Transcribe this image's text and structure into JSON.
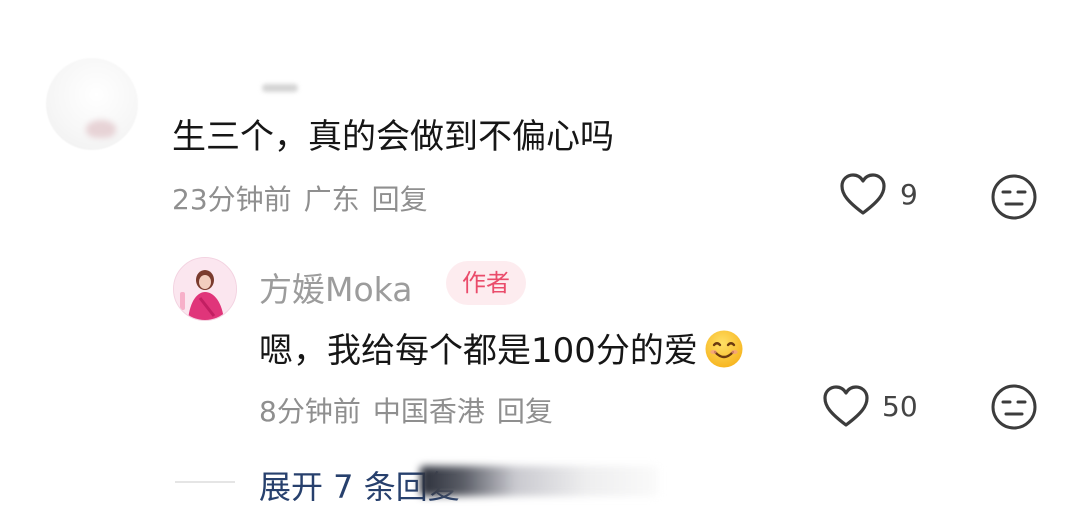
{
  "comment": {
    "text": "生三个，真的会做到不偏心吗",
    "time": "23分钟前",
    "location": "广东",
    "reply_label": "回复",
    "like_count": "9"
  },
  "reply": {
    "author_name": "方媛Moka",
    "author_badge": "作者",
    "text": "嗯，我给每个都是100分的爱",
    "time": "8分钟前",
    "location": "中国香港",
    "reply_label": "回复",
    "like_count": "50"
  },
  "thread": {
    "expand_label": "展开 7 条回复"
  },
  "colors": {
    "badge_text": "#ea4c6b",
    "badge_bg": "#fdecef",
    "link": "#27406d",
    "meta": "#8f8f8f"
  },
  "icons": {
    "like": "heart-outline-icon",
    "dislike": "neutral-face-icon",
    "emoji": "smiling-face-emoji"
  }
}
